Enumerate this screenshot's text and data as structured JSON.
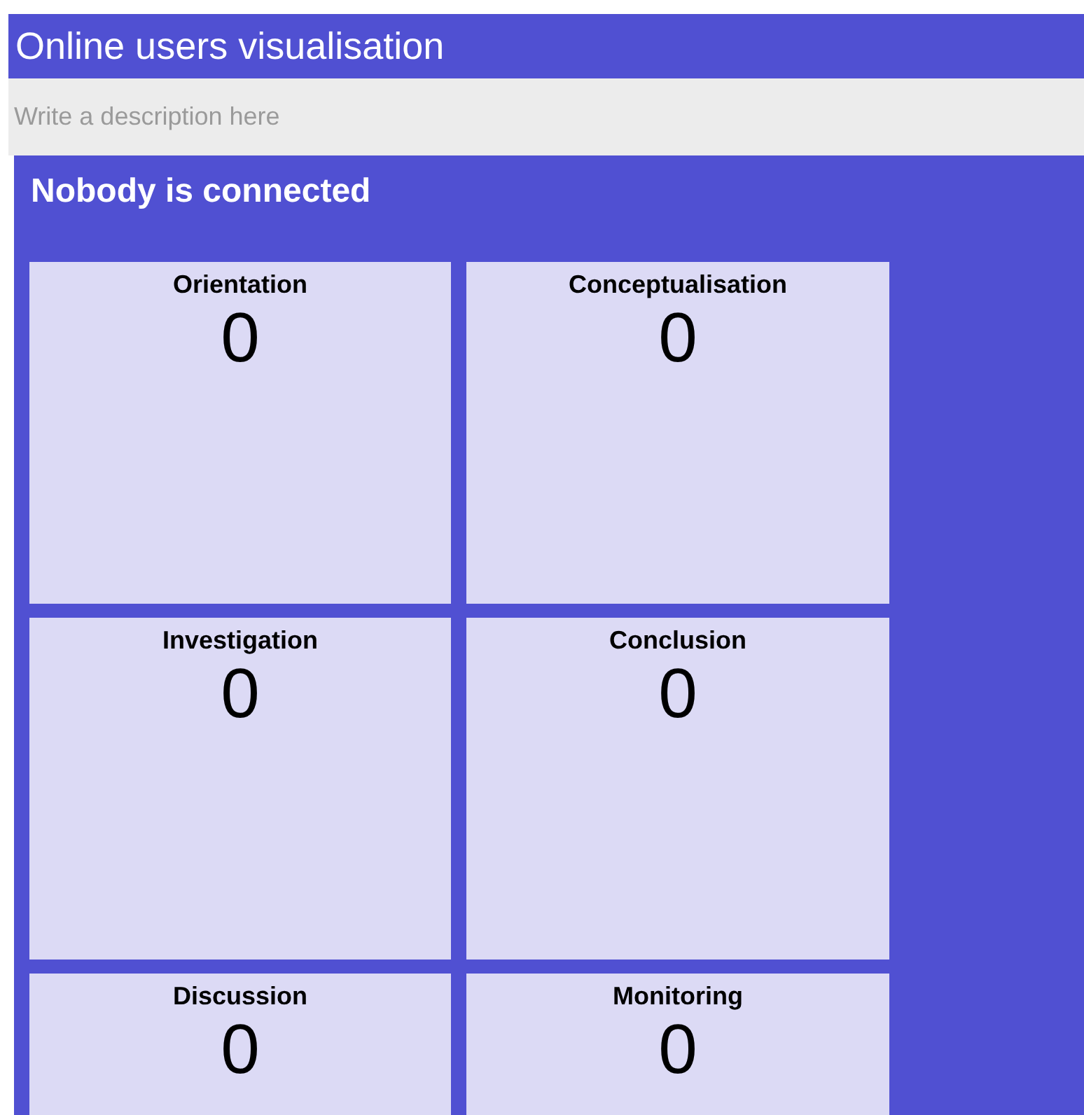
{
  "title": "Online users visualisation",
  "description": {
    "placeholder": "Write a description here"
  },
  "status": "Nobody is connected",
  "phases": [
    {
      "name": "Orientation",
      "count": "0"
    },
    {
      "name": "Conceptualisation",
      "count": "0"
    },
    {
      "name": "Investigation",
      "count": "0"
    },
    {
      "name": "Conclusion",
      "count": "0"
    },
    {
      "name": "Discussion",
      "count": "0"
    },
    {
      "name": "Monitoring",
      "count": "0"
    }
  ]
}
